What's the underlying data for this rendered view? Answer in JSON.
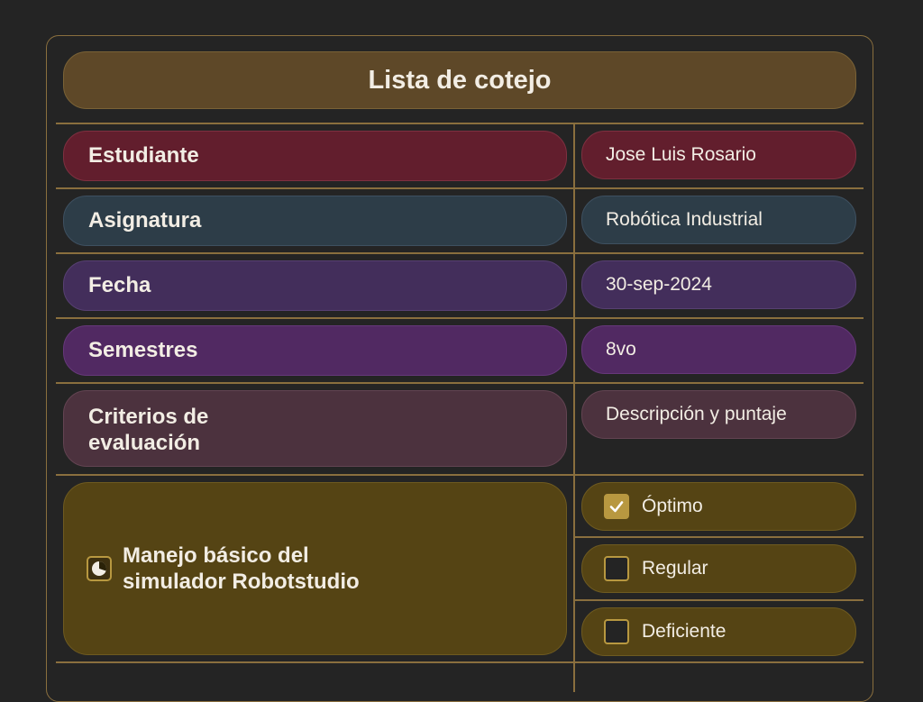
{
  "title": "Lista de cotejo",
  "rows": [
    {
      "label": "Estudiante",
      "value": "Jose Luis Rosario"
    },
    {
      "label": "Asignatura",
      "value": "Robótica Industrial"
    },
    {
      "label": "Fecha",
      "value": "30-sep-2024"
    },
    {
      "label": "Semestres",
      "value": "8vo"
    }
  ],
  "criteria": {
    "label_line1": "Criterios de",
    "label_line2": "evaluación",
    "value": "Descripción y puntaje"
  },
  "criterion": {
    "icon": "pie-chart-icon",
    "line1": "Manejo básico del",
    "line2": "simulador Robotstudio"
  },
  "options": [
    {
      "label": "Óptimo",
      "checked": true
    },
    {
      "label": "Regular",
      "checked": false
    },
    {
      "label": "Deficiente",
      "checked": false
    }
  ],
  "colors": {
    "background": "#242424",
    "border": "#8a6f3e",
    "title": "#5e4828",
    "estudiante": "#621e2d",
    "asignatura": "#2d3d48",
    "fecha": "#432e5b",
    "semestres": "#512962",
    "criterios": "#4c323e",
    "criterion": "#554414",
    "checkbox": "#b89840"
  }
}
